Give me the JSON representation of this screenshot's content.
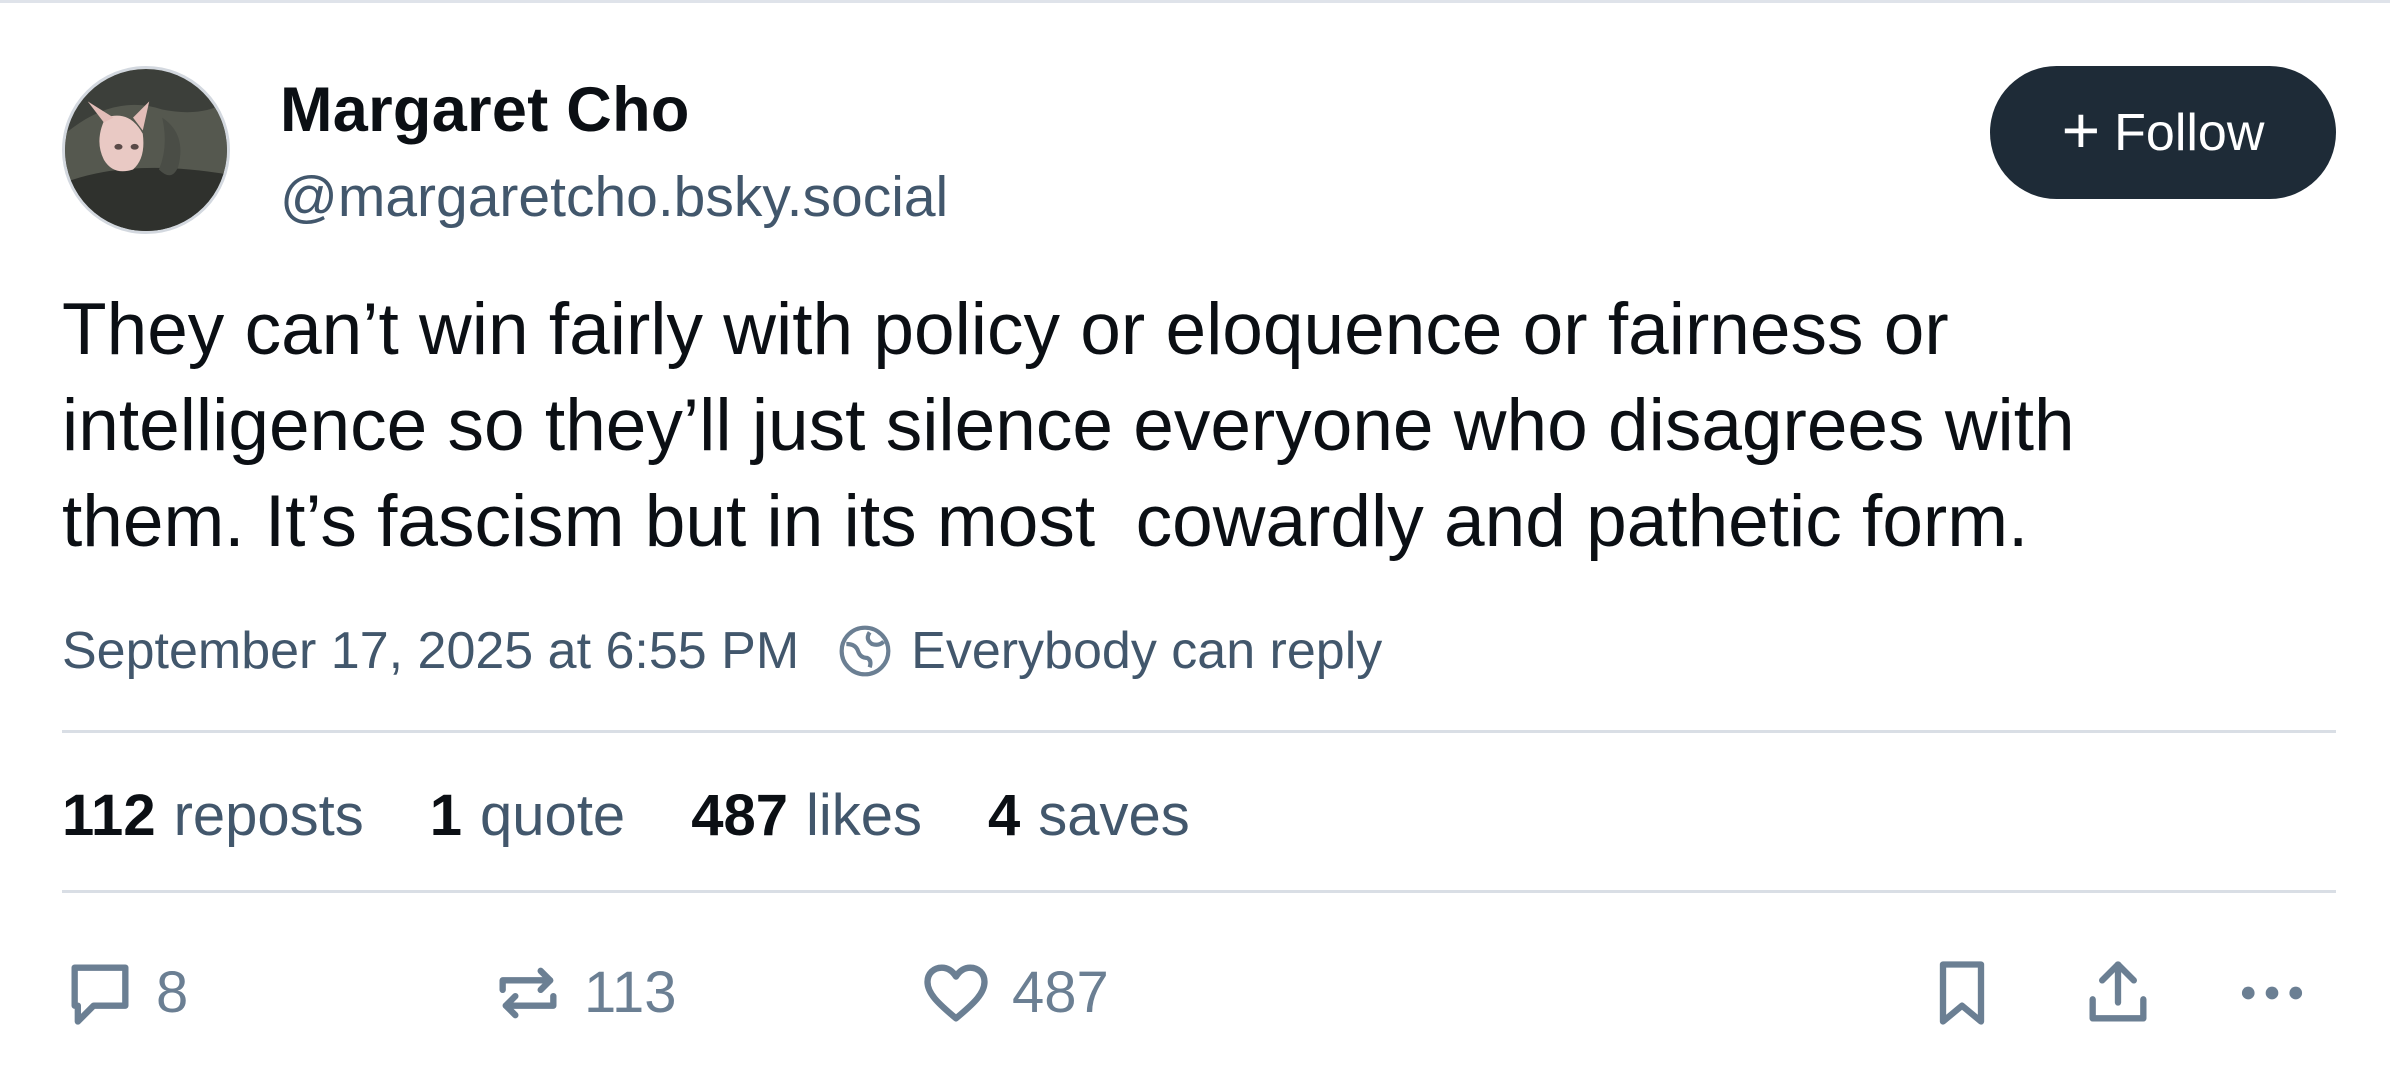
{
  "author": {
    "name": "Margaret Cho",
    "handle": "@margaretcho.bsky.social"
  },
  "follow_button": {
    "label": "Follow",
    "icon": "plus-icon"
  },
  "post": {
    "text": "They can’t win fairly with policy or eloquence or fairness or\nintelligence so they’ll just silence everyone who disagrees with\nthem. It’s fascism but in its most  cowardly and pathetic form.",
    "timestamp": "September 17, 2025 at 6:55 PM",
    "reply_setting": "Everybody can reply"
  },
  "stats": {
    "reposts_count": "112",
    "reposts_label": "reposts",
    "quotes_count": "1",
    "quotes_label": "quote",
    "likes_count": "487",
    "likes_label": "likes",
    "saves_count": "4",
    "saves_label": "saves"
  },
  "actions": {
    "reply_count": "8",
    "repost_count": "113",
    "like_count": "487"
  },
  "colors": {
    "text": "#0b0f14",
    "muted": "#42576c",
    "icon": "#6b7f93",
    "follow_bg": "#1e2b37",
    "divider": "#d9dee5"
  }
}
